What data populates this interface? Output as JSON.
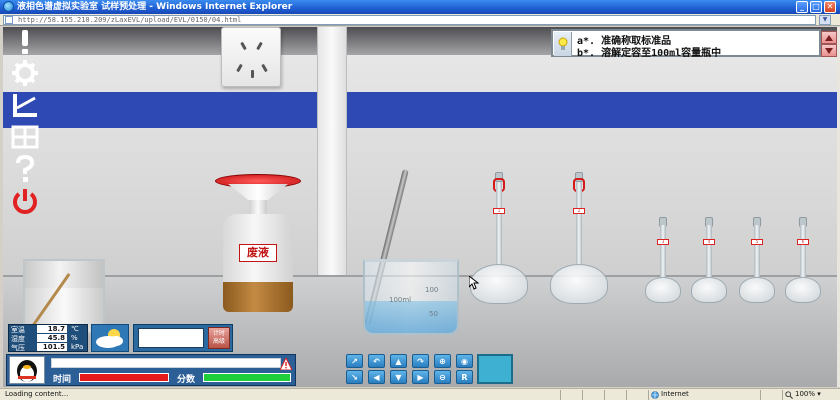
{
  "window": {
    "title": "液相色谱虚拟实验室 试样预处理 - Windows Internet Explorer",
    "minimize_glyph": "_",
    "maximize_glyph": "□",
    "close_glyph": "✕"
  },
  "address": {
    "url": "http://58.155.210.209/zLaxEVL/upload/EVL/0150/04.html"
  },
  "instructions": {
    "lines": [
      "a*. 准确称取标准品",
      "b*. 溶解定容至100ml容量瓶中"
    ]
  },
  "waste_bottle": {
    "label": "废液"
  },
  "beaker": {
    "marks": [
      "100",
      "100ml",
      "50"
    ]
  },
  "flasks": {
    "tags": [
      "1",
      "2",
      "3",
      "4",
      "5",
      "6"
    ]
  },
  "environment": {
    "temp_label": "室温",
    "temp_value": "18.7",
    "temp_unit": "℃",
    "humidity_label": "湿度",
    "humidity_value": "45.8",
    "humidity_unit": "%",
    "pressure_label": "气压",
    "pressure_value": "101.5",
    "pressure_unit": "kPa"
  },
  "timer": {
    "button_label_1": "计时",
    "button_label_2": "高级"
  },
  "userbar": {
    "time_label": "时间",
    "score_label": "分数",
    "time_fraction": 1.0,
    "score_fraction": 1.0
  },
  "statusbar": {
    "status": "Loading content...",
    "zone": "Internet",
    "zoom": "100%"
  },
  "colors": {
    "accent_red": "#d41a1a",
    "wall_blue": "#2f49b4",
    "time_bar": "#e61a1a",
    "score_bar": "#1ecf3a"
  }
}
